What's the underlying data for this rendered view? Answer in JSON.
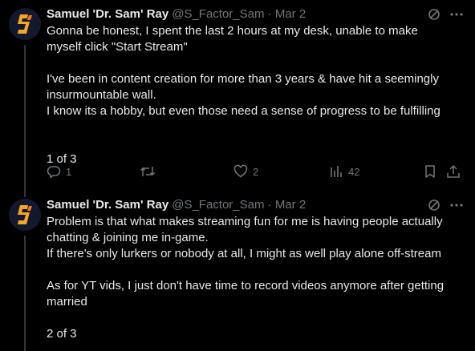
{
  "tweets": [
    {
      "name": "Samuel 'Dr. Sam' Ray",
      "handle": "@S_Factor_Sam",
      "dot": "·",
      "date": "Mar 2",
      "lines": [
        "Gonna be honest, I spent the last 2 hours at my desk, unable to make",
        "myself click \"Start Stream\"",
        "",
        "I've been in content creation for more than 3 years & have hit a seemingly",
        "insurmountable wall.",
        "I know its a hobby, but even those need a sense of progress to be fulfilling",
        "",
        "1 of 3"
      ],
      "replies": "1",
      "likes": "2",
      "views": "42"
    },
    {
      "name": "Samuel 'Dr. Sam' Ray",
      "handle": "@S_Factor_Sam",
      "dot": "·",
      "date": "Mar 2",
      "lines": [
        "Problem is that what makes streaming fun for me is having people actually",
        "chatting & joining me in-game.",
        "If there's only lurkers or nobody at all, I might as well play alone off-stream",
        "",
        "As for YT vids, I just don't have time to record videos anymore after getting",
        "married",
        "",
        "2 of 3"
      ]
    }
  ],
  "colors": {
    "background": "#000000",
    "text": "#e7e9ea",
    "muted": "#71767b",
    "brand": "#f5a623"
  },
  "icons": [
    "grok-icon",
    "more-icon",
    "reply-icon",
    "retweet-icon",
    "like-icon",
    "views-icon",
    "bookmark-icon",
    "share-icon"
  ]
}
